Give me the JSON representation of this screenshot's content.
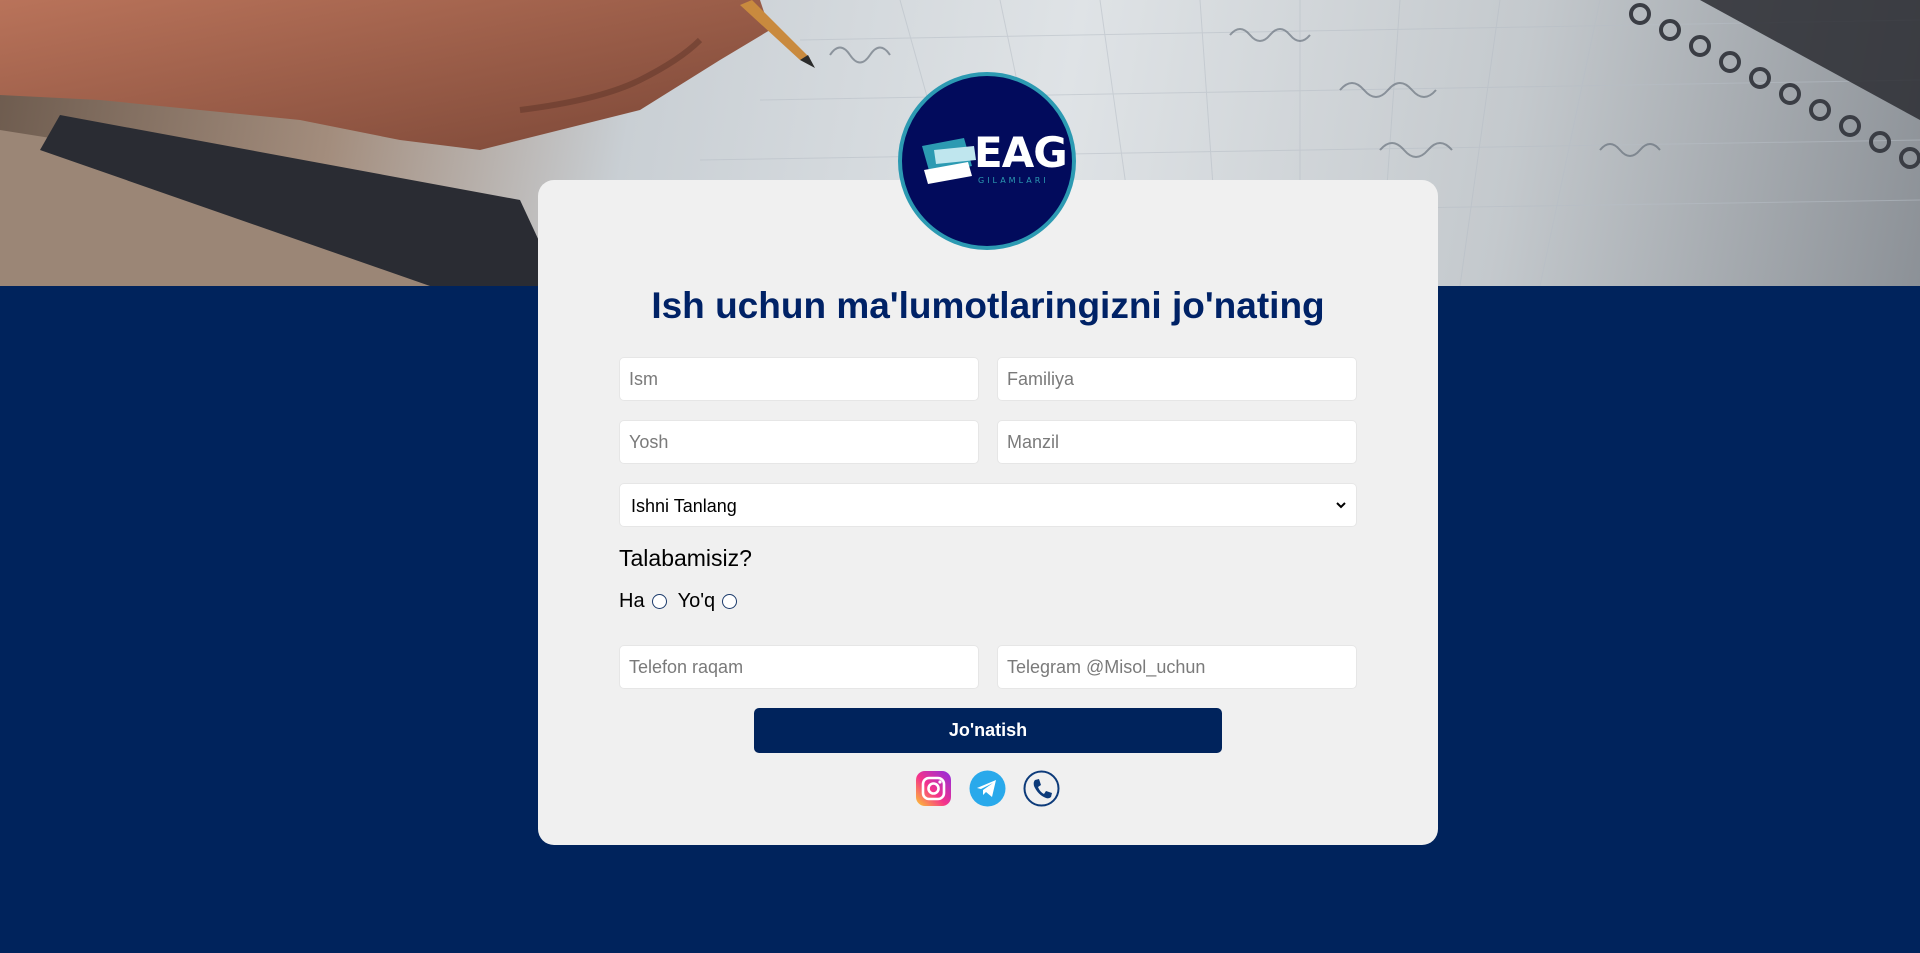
{
  "logo": {
    "main": "EAG",
    "sub": "GILAMLARI"
  },
  "form": {
    "title": "Ish uchun ma'lumotlaringizni jo'nating",
    "first_name_placeholder": "Ism",
    "last_name_placeholder": "Familiya",
    "age_placeholder": "Yosh",
    "address_placeholder": "Manzil",
    "job_select_value": "Ishni Tanlang",
    "student_question": "Talabamisiz?",
    "yes_label": "Ha",
    "no_label": "Yo'q",
    "phone_placeholder": "Telefon raqam",
    "telegram_placeholder": "Telegram @Misol_uchun",
    "submit_label": "Jo'natish"
  },
  "social": [
    "instagram-icon",
    "telegram-icon",
    "phone-icon"
  ],
  "colors": {
    "navy": "#00235c",
    "card": "#f0f0f0",
    "logo_bg": "#020b5c",
    "logo_accent": "#2c9ab2",
    "telegram": "#29a9eb"
  }
}
